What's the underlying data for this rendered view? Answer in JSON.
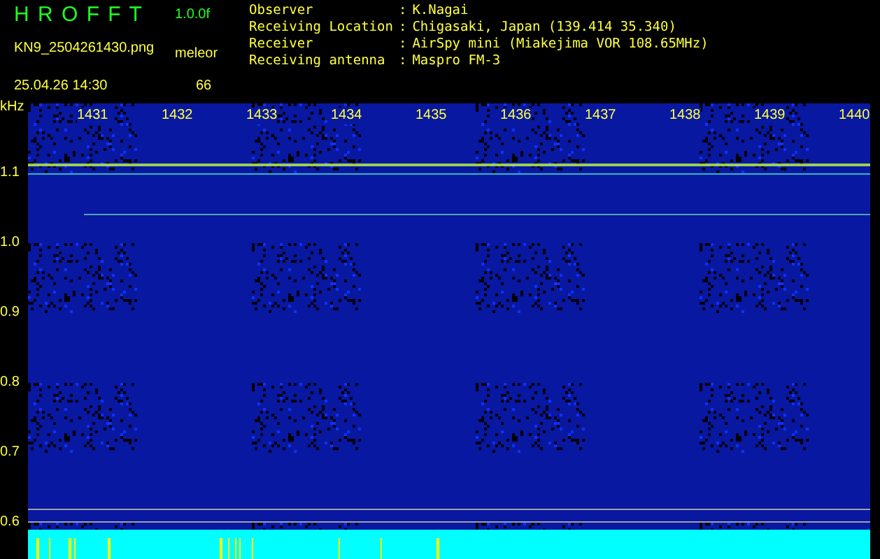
{
  "header": {
    "title": "H R O F F T",
    "version": "1.0.0f",
    "filename": "KN9_2504261430.png",
    "datetime": "25.04.26 14:30",
    "count_label": "meleor",
    "count": "66"
  },
  "info": [
    {
      "label": "Observer",
      "separator": ":",
      "value": "K.Nagai"
    },
    {
      "label": "Receiving Location",
      "separator": ":",
      "value": "Chigasaki, Japan (139.414 35.340)"
    },
    {
      "label": "Receiver",
      "separator": ":",
      "value": "AirSpy mini (Miakejima VOR 108.65MHz)"
    },
    {
      "label": "Receiving antenna",
      "separator": ":",
      "value": "Maspro FM-3"
    }
  ],
  "spectrogram": {
    "unit": "kHz",
    "y_labels": [
      "1.1",
      "1.0",
      "0.9",
      "0.8",
      "0.7",
      "0.6"
    ],
    "time_labels": [
      "1431",
      "1432",
      "1433",
      "1434",
      "1435",
      "1436",
      "1437",
      "1438",
      "1439",
      "1440"
    ]
  }
}
